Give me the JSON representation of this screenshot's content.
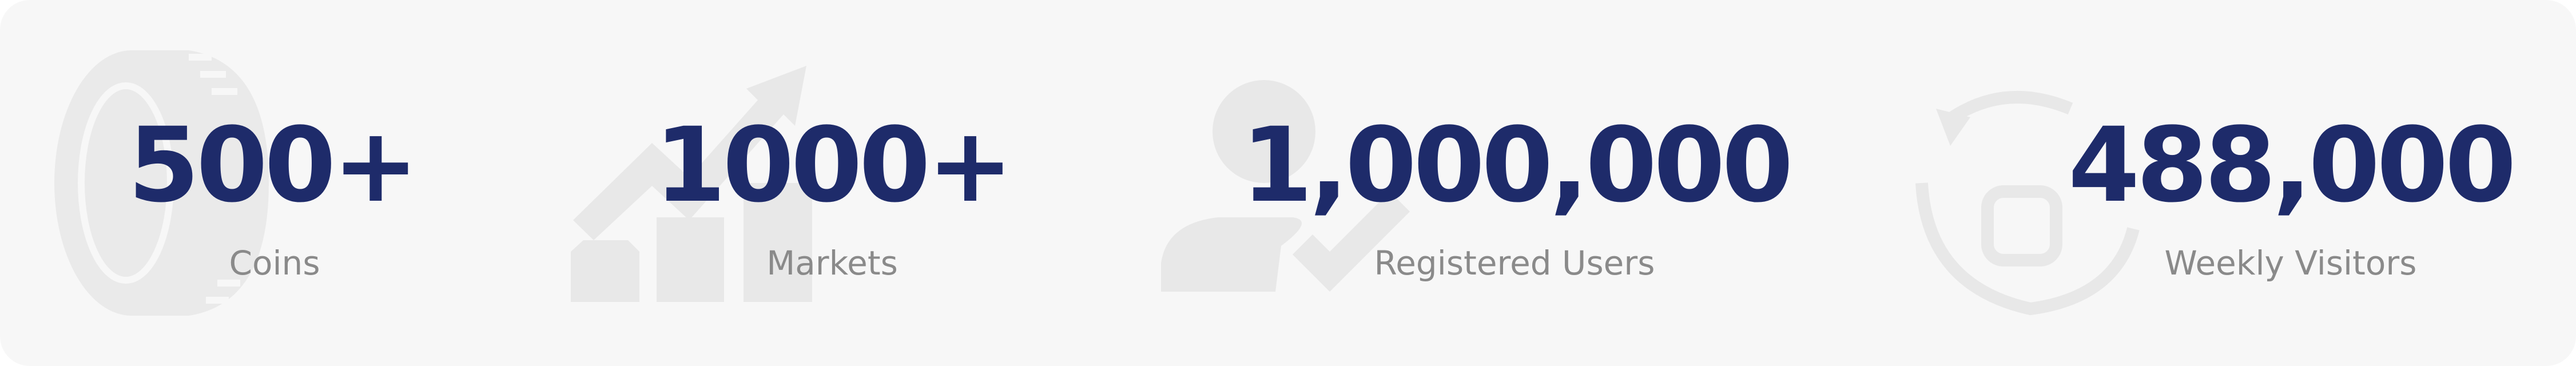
{
  "colors": {
    "panel_background": "#f7f7f7",
    "value_text": "#1e2b6a",
    "label_text": "#8a8a8a",
    "icon_fill": "#e8e8e8"
  },
  "stats": [
    {
      "value": "500+",
      "label": "Coins",
      "icon": "coin-icon"
    },
    {
      "value": "1000+",
      "label": "Markets",
      "icon": "chart-growth-icon"
    },
    {
      "value": "1,000,000",
      "label": "Registered Users",
      "icon": "user-check-icon"
    },
    {
      "value": "488,000",
      "label": "Weekly Visitors",
      "icon": "recycle-cycle-icon"
    }
  ]
}
